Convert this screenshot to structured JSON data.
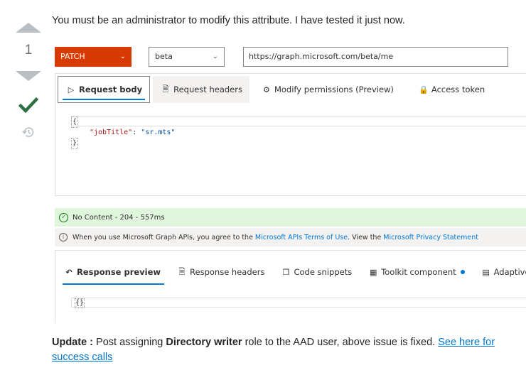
{
  "vote": {
    "count": "1"
  },
  "answer": {
    "intro": "You must be an administrator to modify this attribute. I have tested it just now.",
    "update_label": "Update :",
    "update_pre": " Post assigning ",
    "update_bold": "Directory writer",
    "update_post": " role to the AAD user, above issue is fixed. ",
    "update_link": "See here for success calls"
  },
  "explorer": {
    "method": "PATCH",
    "version": "beta",
    "url": "https://graph.microsoft.com/beta/me",
    "request_tabs": [
      {
        "label": "Request body",
        "icon": "send-icon"
      },
      {
        "label": "Request headers",
        "icon": "headers-icon"
      },
      {
        "label": "Modify permissions (Preview)",
        "icon": "permissions-icon"
      },
      {
        "label": "Access token",
        "icon": "lock-icon"
      }
    ],
    "body": {
      "open": "{",
      "key": "\"jobTitle\"",
      "colon": ": ",
      "value": "\"sr.mts\"",
      "close": "}"
    },
    "status": "No Content - 204 - 557ms",
    "terms": {
      "pre": "When you use Microsoft Graph APIs, you agree to the",
      "link1": "Microsoft APIs Terms of Use",
      "mid": ". View the",
      "link2": "Microsoft Privacy Statement"
    },
    "response_tabs": [
      {
        "label": "Response preview",
        "icon": "undo-icon"
      },
      {
        "label": "Response headers",
        "icon": "headers-icon"
      },
      {
        "label": "Code snippets",
        "icon": "code-icon"
      },
      {
        "label": "Toolkit component",
        "icon": "toolkit-icon"
      },
      {
        "label": "Adaptive cards",
        "icon": "card-icon"
      }
    ],
    "response_body": "{}"
  },
  "colors": {
    "accent": "#0078d4",
    "method": "#d83b01",
    "success": "#dff6dd",
    "accepted": "#2f6f44"
  }
}
